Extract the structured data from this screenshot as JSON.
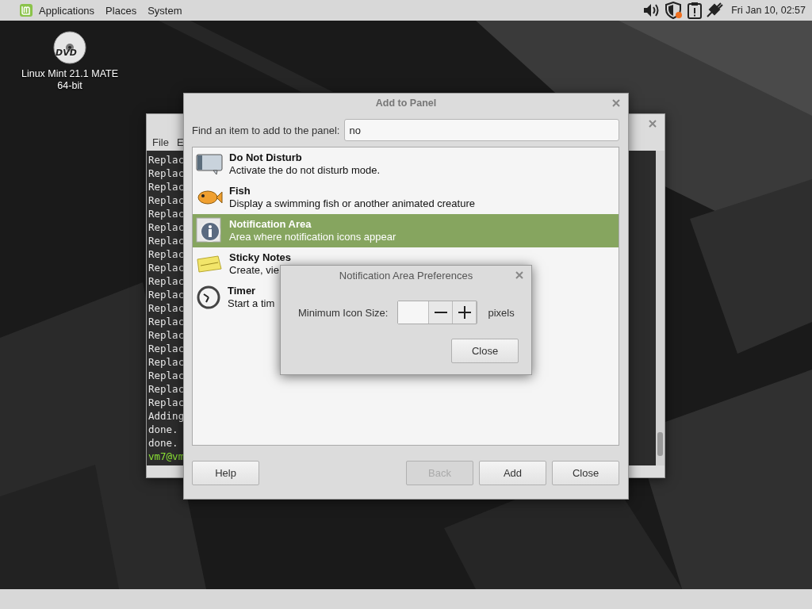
{
  "top_panel": {
    "menus": [
      {
        "label": "Applications"
      },
      {
        "label": "Places"
      },
      {
        "label": "System"
      }
    ],
    "clock": "Fri Jan 10, 02:57"
  },
  "desktop_icons": [
    {
      "label": "Linux Mint 21.1 MATE 64-bit",
      "disc_label": "DVD"
    }
  ],
  "terminal": {
    "menus": [
      "File",
      "E"
    ],
    "lines": [
      {
        "text": "Replac",
        "kind": "output"
      },
      {
        "text": "Replac",
        "kind": "output"
      },
      {
        "text": "Replac",
        "kind": "output"
      },
      {
        "text": "Replac",
        "kind": "output"
      },
      {
        "text": "Replac",
        "kind": "output"
      },
      {
        "text": "Replac",
        "kind": "output"
      },
      {
        "text": "Replac",
        "kind": "output"
      },
      {
        "text": "Replac",
        "kind": "output"
      },
      {
        "text": "Replac",
        "kind": "output"
      },
      {
        "text": "Replac",
        "kind": "output"
      },
      {
        "text": "Replac",
        "kind": "output"
      },
      {
        "text": "Replac",
        "kind": "output"
      },
      {
        "text": "Replac",
        "kind": "output"
      },
      {
        "text": "Replac",
        "kind": "output"
      },
      {
        "text": "Replac",
        "kind": "output"
      },
      {
        "text": "Replac",
        "kind": "output"
      },
      {
        "text": "Replac",
        "kind": "output"
      },
      {
        "text": "Replac",
        "kind": "output"
      },
      {
        "text": "Replac",
        "kind": "output"
      },
      {
        "text": "Adding",
        "kind": "output"
      },
      {
        "text": "done.",
        "kind": "output"
      },
      {
        "text": "done.",
        "kind": "output"
      },
      {
        "text": "vm7@vm",
        "kind": "prompt"
      }
    ]
  },
  "add_to_panel": {
    "title": "Add to Panel",
    "search_label": "Find an item to add to the panel:",
    "search_value": "no",
    "items": [
      {
        "name": "Do Not Disturb",
        "description": "Activate the do not disturb mode.",
        "selected": false
      },
      {
        "name": "Fish",
        "description": "Display a swimming fish or another animated creature",
        "selected": false
      },
      {
        "name": "Notification Area",
        "description": "Area where notification icons appear",
        "selected": true
      },
      {
        "name": "Sticky Notes",
        "description": "Create, vie",
        "selected": false
      },
      {
        "name": "Timer",
        "description": "Start a tim",
        "selected": false
      }
    ],
    "buttons": [
      {
        "label": "Help",
        "disabled": false,
        "kind": "left"
      },
      {
        "label": "Back",
        "disabled": true,
        "kind": "right"
      },
      {
        "label": "Add",
        "disabled": false,
        "kind": "right"
      },
      {
        "label": "Close",
        "disabled": false,
        "kind": "right"
      }
    ]
  },
  "prefs_dialog": {
    "title": "Notification Area Preferences",
    "label": "Minimum Icon Size:",
    "unit": "pixels",
    "buttons": [
      "Close"
    ]
  }
}
